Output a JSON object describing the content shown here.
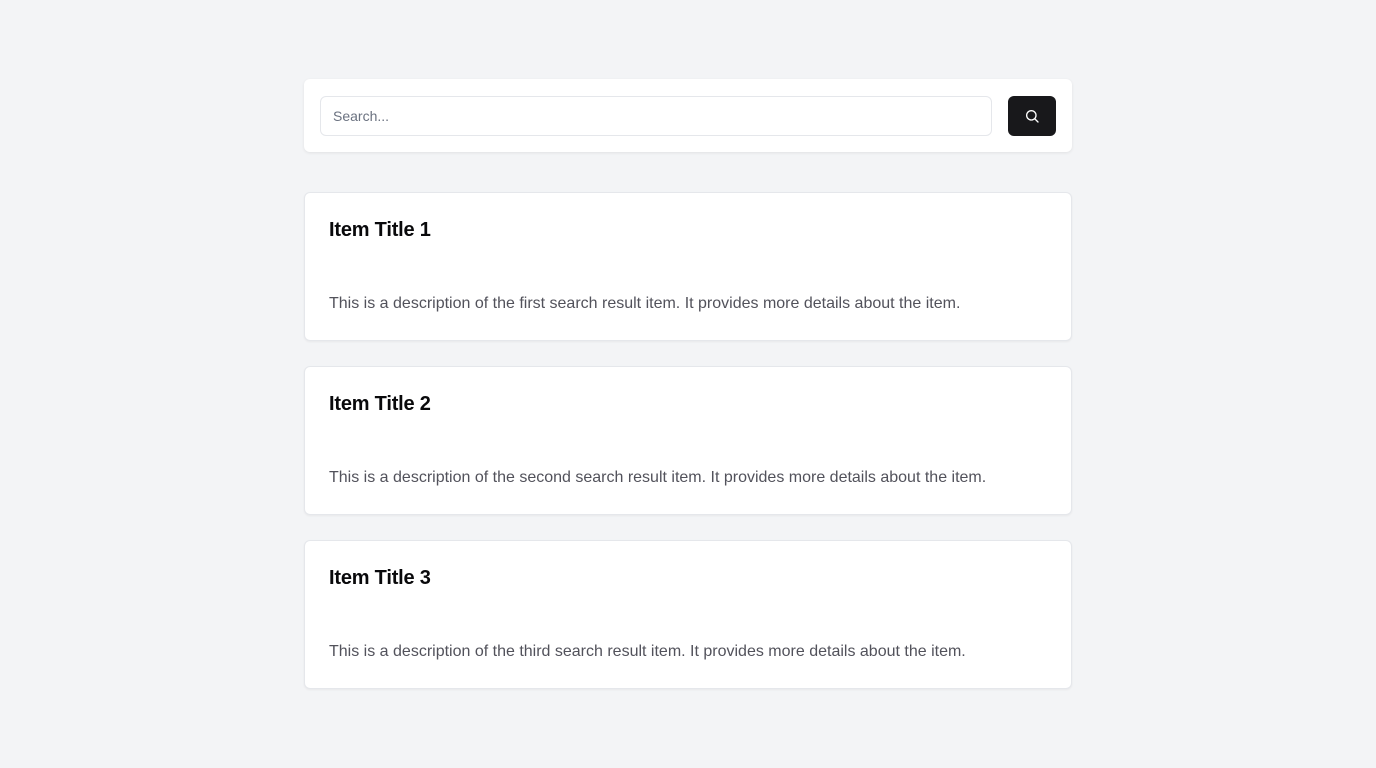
{
  "search": {
    "placeholder": "Search...",
    "value": "",
    "button_icon": "search-icon"
  },
  "results": [
    {
      "title": "Item Title 1",
      "description": "This is a description of the first search result item. It provides more details about the item."
    },
    {
      "title": "Item Title 2",
      "description": "This is a description of the second search result item. It provides more details about the item."
    },
    {
      "title": "Item Title 3",
      "description": "This is a description of the third search result item. It provides more details about the item."
    }
  ],
  "colors": {
    "background": "#f3f4f6",
    "card": "#ffffff",
    "button": "#18181b",
    "title": "#09090b",
    "description": "#52525b"
  }
}
